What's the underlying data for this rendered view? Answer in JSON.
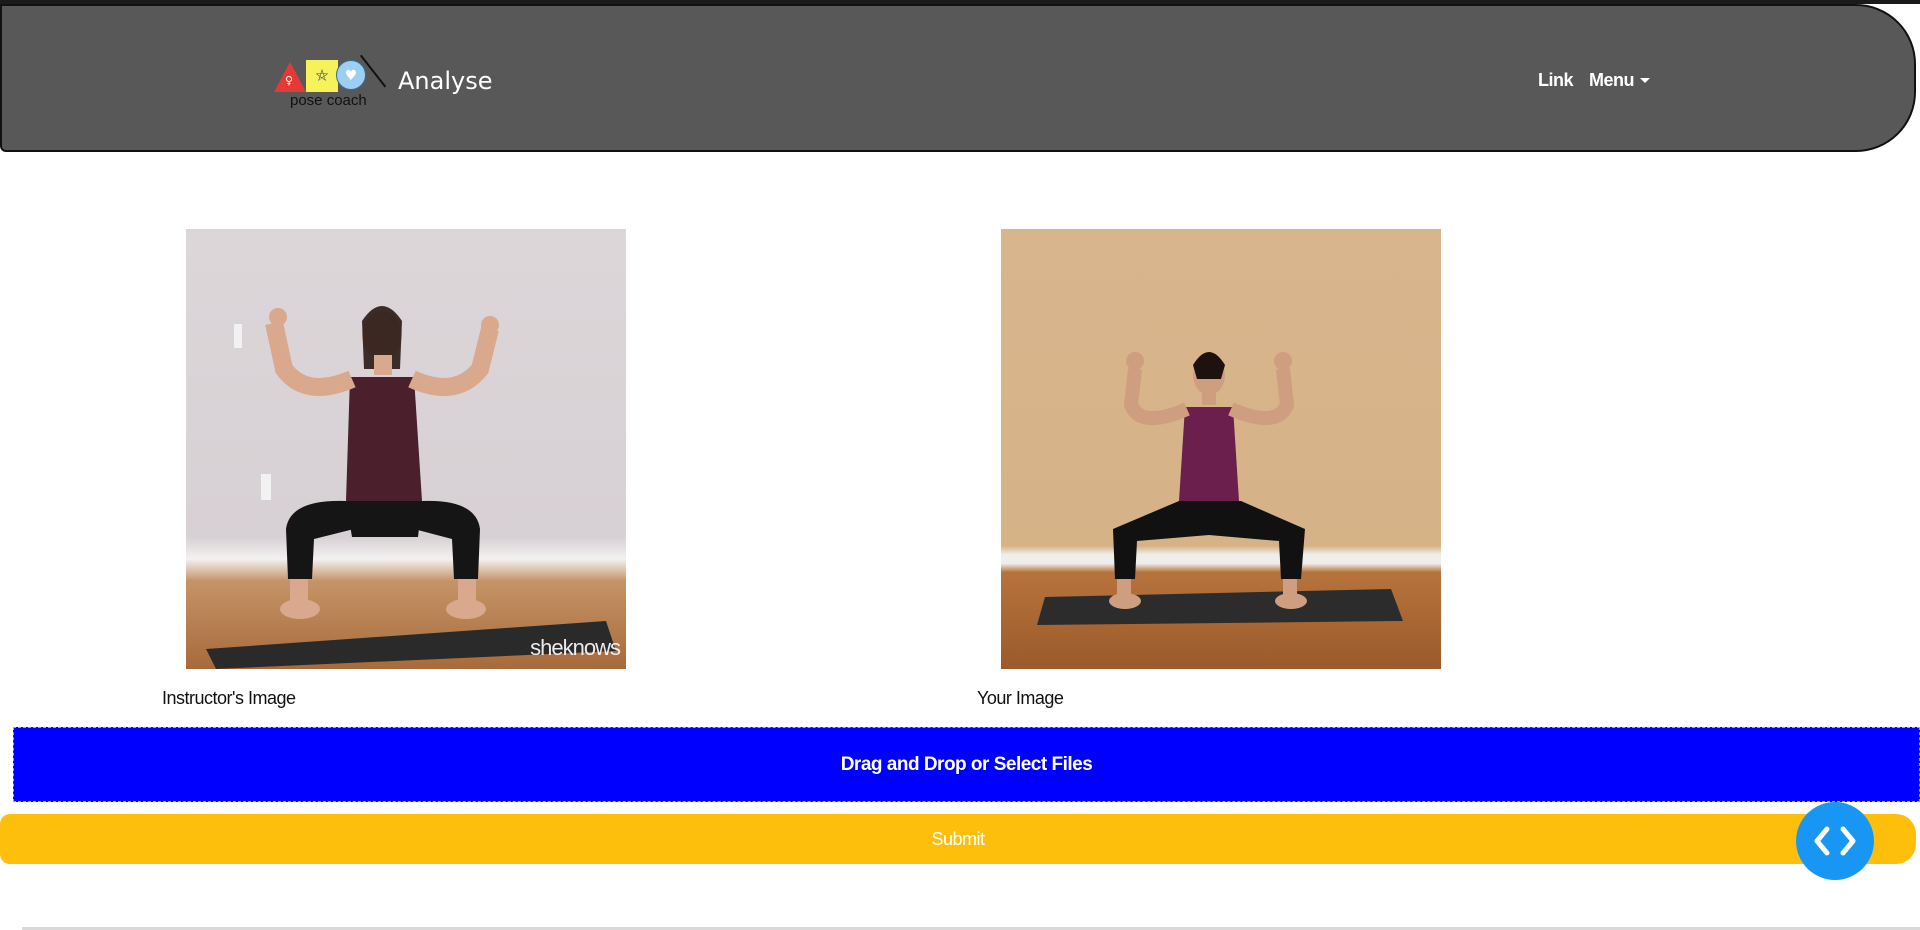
{
  "navbar": {
    "logo_caption": "pose coach",
    "brand_title": "Analyse",
    "links": {
      "link_label": "Link",
      "menu_label": "Menu"
    },
    "icons": [
      "logo-triangle-icon",
      "logo-square-icon",
      "logo-circle-icon",
      "caret-down-icon"
    ]
  },
  "main": {
    "instructor_caption": "Instructor's Image",
    "user_caption": "Your Image",
    "watermark": "sheknows"
  },
  "upload": {
    "dropzone_label": "Drag and Drop or Select Files",
    "submit_label": "Submit"
  },
  "fab": {
    "icon": "code-brackets-icon"
  },
  "colors": {
    "navbar_bg": "#585858",
    "dropzone_bg": "#0000fe",
    "submit_bg": "#fdbf0b",
    "fab_bg": "#1797f3"
  }
}
